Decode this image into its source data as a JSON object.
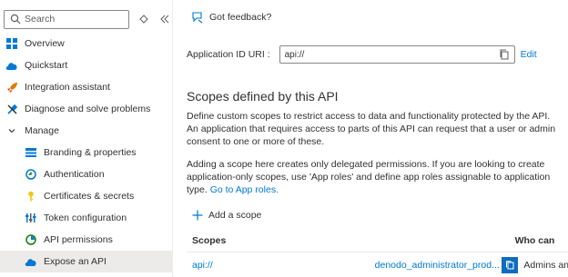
{
  "sidebar": {
    "search_placeholder": "Search",
    "items": [
      {
        "label": "Overview"
      },
      {
        "label": "Quickstart"
      },
      {
        "label": "Integration assistant"
      },
      {
        "label": "Diagnose and solve problems"
      },
      {
        "label": "Manage"
      },
      {
        "label": "Branding & properties"
      },
      {
        "label": "Authentication"
      },
      {
        "label": "Certificates & secrets"
      },
      {
        "label": "Token configuration"
      },
      {
        "label": "API permissions"
      },
      {
        "label": "Expose an API"
      }
    ]
  },
  "header": {
    "feedback_label": "Got feedback?"
  },
  "app_id_uri": {
    "label": "Application ID URI :",
    "value": "api://",
    "edit_label": "Edit"
  },
  "scopes_section": {
    "title": "Scopes defined by this API",
    "description": "Define custom scopes to restrict access to data and functionality protected by the API. An application that requires access to parts of this API can request that a user or admin consent to one or more of these.",
    "delegated_text": "Adding a scope here creates only delegated permissions. If you are looking to create application-only scopes, use 'App roles' and define app roles assignable to application type.",
    "go_to_app_roles": "Go to App roles.",
    "add_scope_label": "Add a scope",
    "table": {
      "headers": [
        "Scopes",
        "Who can"
      ],
      "rows": [
        {
          "scope": "api://",
          "name": "denodo_administrator_prod...",
          "who": "Admins an"
        }
      ]
    }
  },
  "colors": {
    "accent": "#0078d4",
    "selected_bg": "#edebe9",
    "text": "#323130"
  }
}
